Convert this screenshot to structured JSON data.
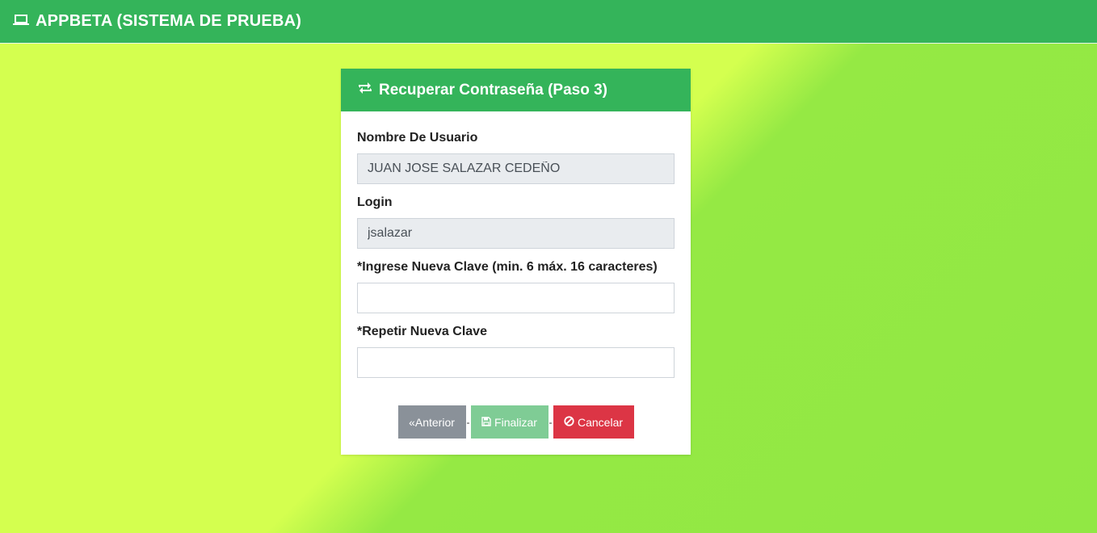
{
  "navbar": {
    "brand_icon": "laptop-icon",
    "brand_text": "APPBETA (SISTEMA DE PRUEBA)"
  },
  "card": {
    "header_icon": "retweet-icon",
    "title": "Recuperar Contraseña (Paso 3)"
  },
  "form": {
    "username_label": "Nombre De Usuario",
    "username_value": "JUAN JOSE SALAZAR CEDEÑO",
    "login_label": "Login",
    "login_value": "jsalazar",
    "new_password_label": "*Ingrese Nueva Clave (min. 6 máx. 16 caracteres)",
    "new_password_value": "",
    "repeat_password_label": "*Repetir Nueva Clave",
    "repeat_password_value": ""
  },
  "buttons": {
    "previous_label": "«Anterior",
    "finish_label": "Finalizar",
    "finish_icon": "save-icon",
    "cancel_label": "Cancelar",
    "cancel_icon": "ban-icon",
    "separator": "-"
  },
  "colors": {
    "navbar": "#34b45a",
    "background_light": "#d4ff4f",
    "background_dark": "#91e844",
    "previous_button": "#8a9199",
    "finish_button": "#7fcc95",
    "cancel_button": "#dc3545"
  }
}
